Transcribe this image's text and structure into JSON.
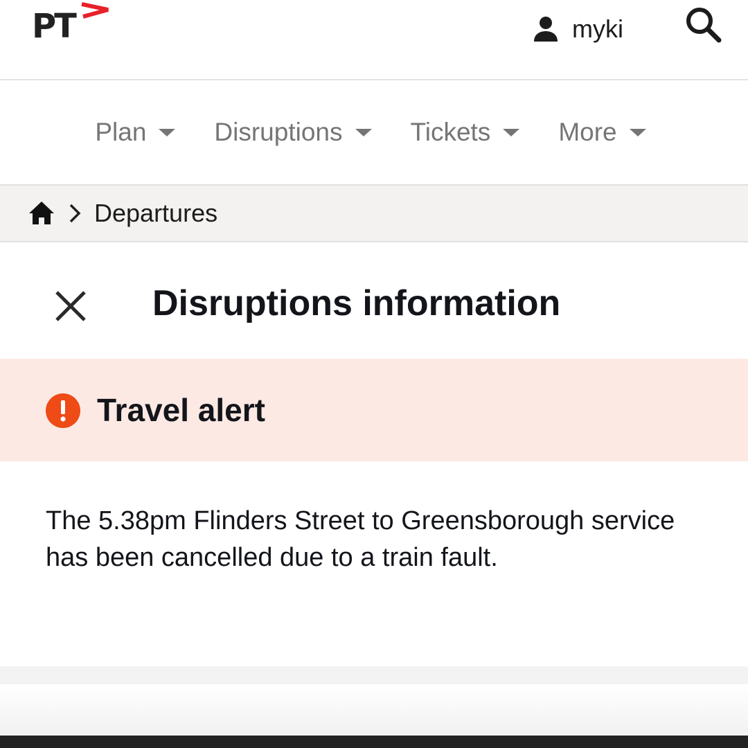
{
  "header": {
    "logo_text": "PT",
    "account_label": "myki",
    "icons": {
      "account": "person-icon",
      "search": "search-icon"
    }
  },
  "nav": {
    "items": [
      {
        "label": "Plan"
      },
      {
        "label": "Disruptions"
      },
      {
        "label": "Tickets"
      },
      {
        "label": "More"
      }
    ]
  },
  "breadcrumb": {
    "home_icon": "home-icon",
    "current": "Departures"
  },
  "panel": {
    "title": "Disruptions information",
    "close_icon": "close-icon"
  },
  "alert": {
    "title": "Travel alert",
    "icon": "exclamation-circle-icon",
    "message": "The 5.38pm Flinders Street to Greensborough service has been cancelled due to a train fault."
  },
  "colors": {
    "brand_red": "#e8202a",
    "alert_background": "#fde9e3",
    "alert_icon": "#ee4b16",
    "breadcrumb_background": "#f3f2f1",
    "nav_text": "#757575"
  }
}
